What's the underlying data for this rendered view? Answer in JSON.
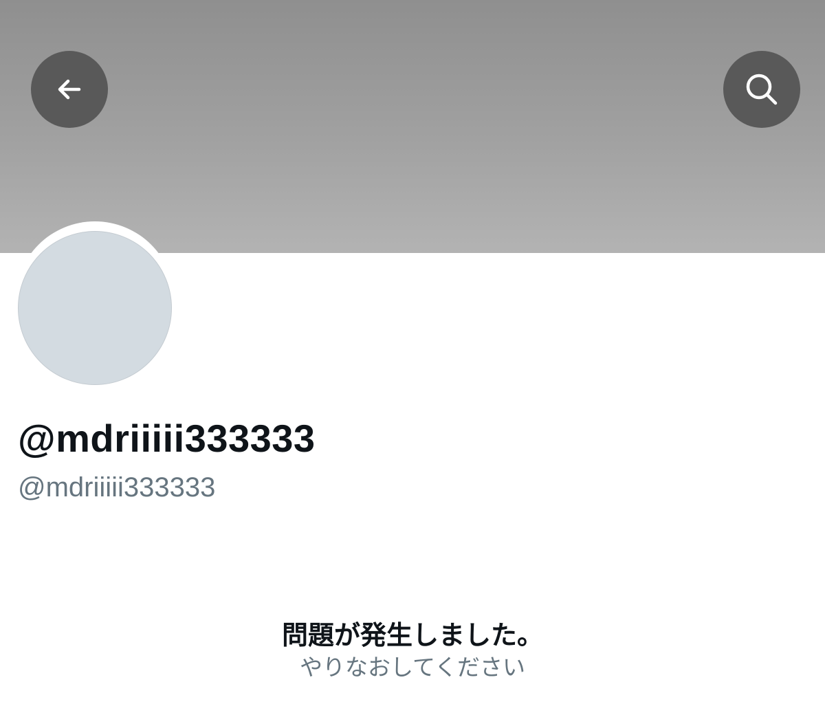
{
  "header": {
    "back_icon": "arrow-left-icon",
    "search_icon": "search-icon"
  },
  "profile": {
    "display_name": "@mdriiiii333333",
    "handle": "@mdriiiii333333"
  },
  "error": {
    "title": "問題が発生しました。",
    "retry_text": "やりなおしてください"
  },
  "colors": {
    "banner": "#9e9e9e",
    "icon_button_bg": "#595959",
    "avatar_bg": "#d3dbe1",
    "primary_text": "#0f1419",
    "secondary_text": "#66757f"
  }
}
